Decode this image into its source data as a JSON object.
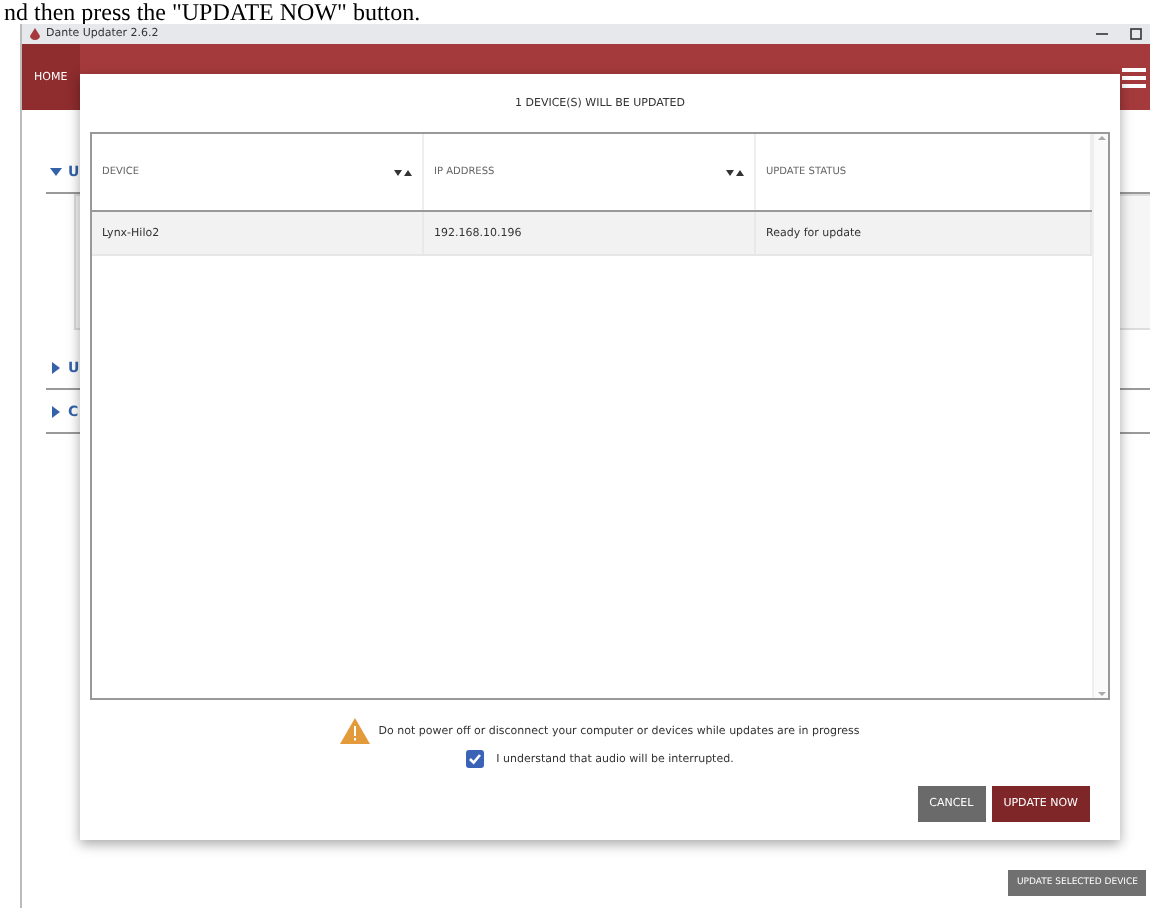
{
  "caption": "nd then press the \"UPDATE NOW\" button.",
  "window": {
    "title": "Dante Updater 2.6.2"
  },
  "header": {
    "tab": "HOME"
  },
  "sections": [
    {
      "label": "U",
      "expanded": true
    },
    {
      "label": "U",
      "expanded": false
    },
    {
      "label": "C",
      "expanded": false
    }
  ],
  "dialog": {
    "title": "1 DEVICE(S) WILL BE UPDATED",
    "columns": [
      "DEVICE",
      "IP ADDRESS",
      "UPDATE STATUS"
    ],
    "rows": [
      {
        "cells": [
          "Lynx-Hilo2",
          "192.168.10.196",
          "Ready for update"
        ],
        "selected": true
      }
    ],
    "warning": "Do not power off or disconnect your computer or devices while updates are in progress",
    "acknowledge": {
      "label": "I understand that audio will be interrupted.",
      "checked": true
    },
    "buttons": [
      {
        "label": "CANCEL",
        "kind": "secondary"
      },
      {
        "label": "UPDATE NOW",
        "kind": "primary"
      }
    ]
  },
  "footer_button": "UPDATE SELECTED DEVICE"
}
